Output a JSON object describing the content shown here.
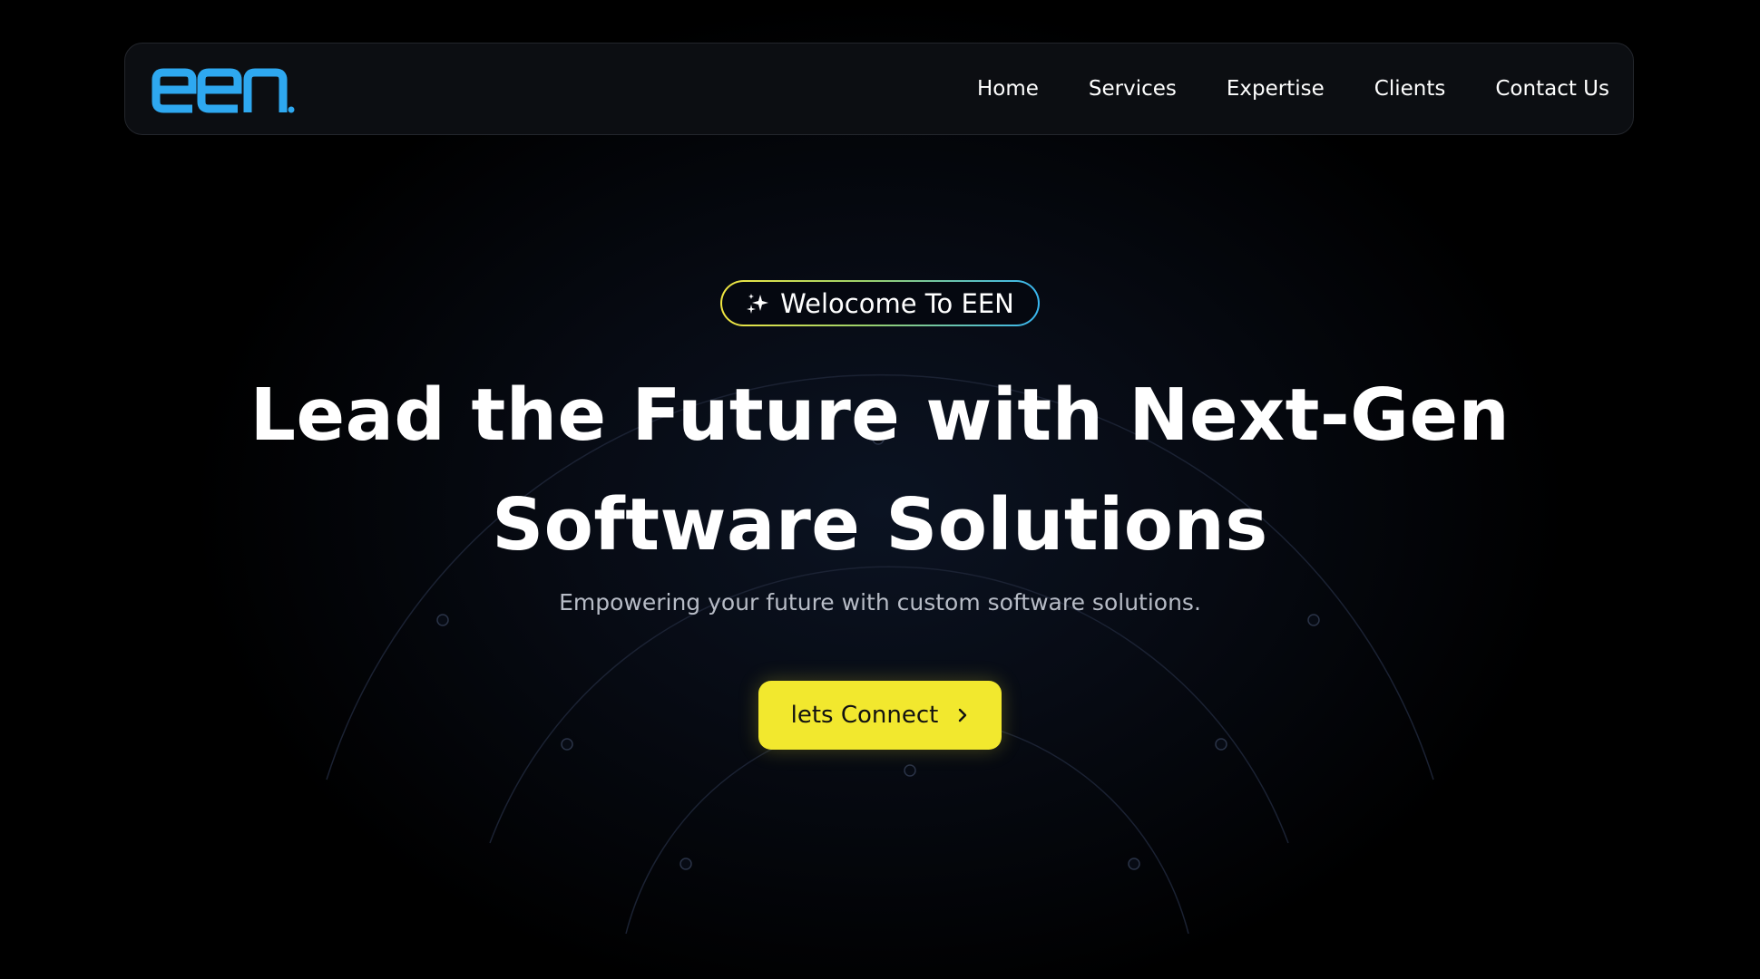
{
  "brand": {
    "logo_text": "een",
    "logo_color": "#2ea8f0"
  },
  "nav": {
    "items": [
      {
        "label": "Home"
      },
      {
        "label": "Services"
      },
      {
        "label": "Expertise"
      },
      {
        "label": "Clients"
      },
      {
        "label": "Contact Us"
      }
    ]
  },
  "hero": {
    "badge": {
      "icon": "sparkles-icon",
      "text": "Welocome To EEN"
    },
    "headline_line1": "Lead the Future with Next-Gen",
    "headline_line2": "Software Solutions",
    "subtitle": "Empowering your future with custom software solutions.",
    "cta": {
      "label": "lets Connect",
      "icon": "chevron-right-icon",
      "color": "#f2e82e"
    }
  },
  "colors": {
    "background": "#000000",
    "accent_yellow": "#f2e82e",
    "accent_blue": "#38b6f0",
    "text_primary": "#ffffff",
    "text_secondary": "#b7bcc6"
  }
}
